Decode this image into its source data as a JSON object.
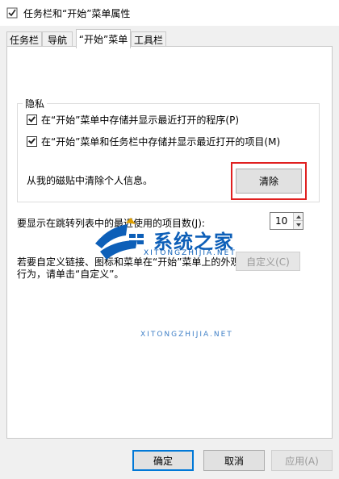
{
  "window": {
    "title": "任务栏和“开始”菜单属性"
  },
  "tabs": [
    {
      "label": "任务栏"
    },
    {
      "label": "导航"
    },
    {
      "label": "“开始”菜单"
    },
    {
      "label": "工具栏"
    }
  ],
  "privacy": {
    "group_label": "隐私",
    "checkbox1_label": "在“开始”菜单中存储并显示最近打开的程序(P)",
    "checkbox1_checked": true,
    "checkbox2_label": "在“开始”菜单和任务栏中存储并显示最近打开的项目(M)",
    "checkbox2_checked": true,
    "clear_text": "从我的磁贴中清除个人信息。",
    "clear_button": "清除"
  },
  "jumplist": {
    "label": "要显示在跳转列表中的最近使用的项目数(J):",
    "value": "10"
  },
  "customize": {
    "text_line1": "若要自定义链接、图标和菜单在“开始”菜单上的外观和",
    "text_line2": "行为，请单击“自定义”。",
    "button": "自定义(C)"
  },
  "watermark": {
    "text": "系统之家",
    "sub": "XITONGZHIJIA.NET"
  },
  "footer": {
    "ok": "确定",
    "cancel": "取消",
    "apply": "应用(A)"
  },
  "colors": {
    "highlight": "#e02020",
    "watermark": "#0d5fb8"
  }
}
